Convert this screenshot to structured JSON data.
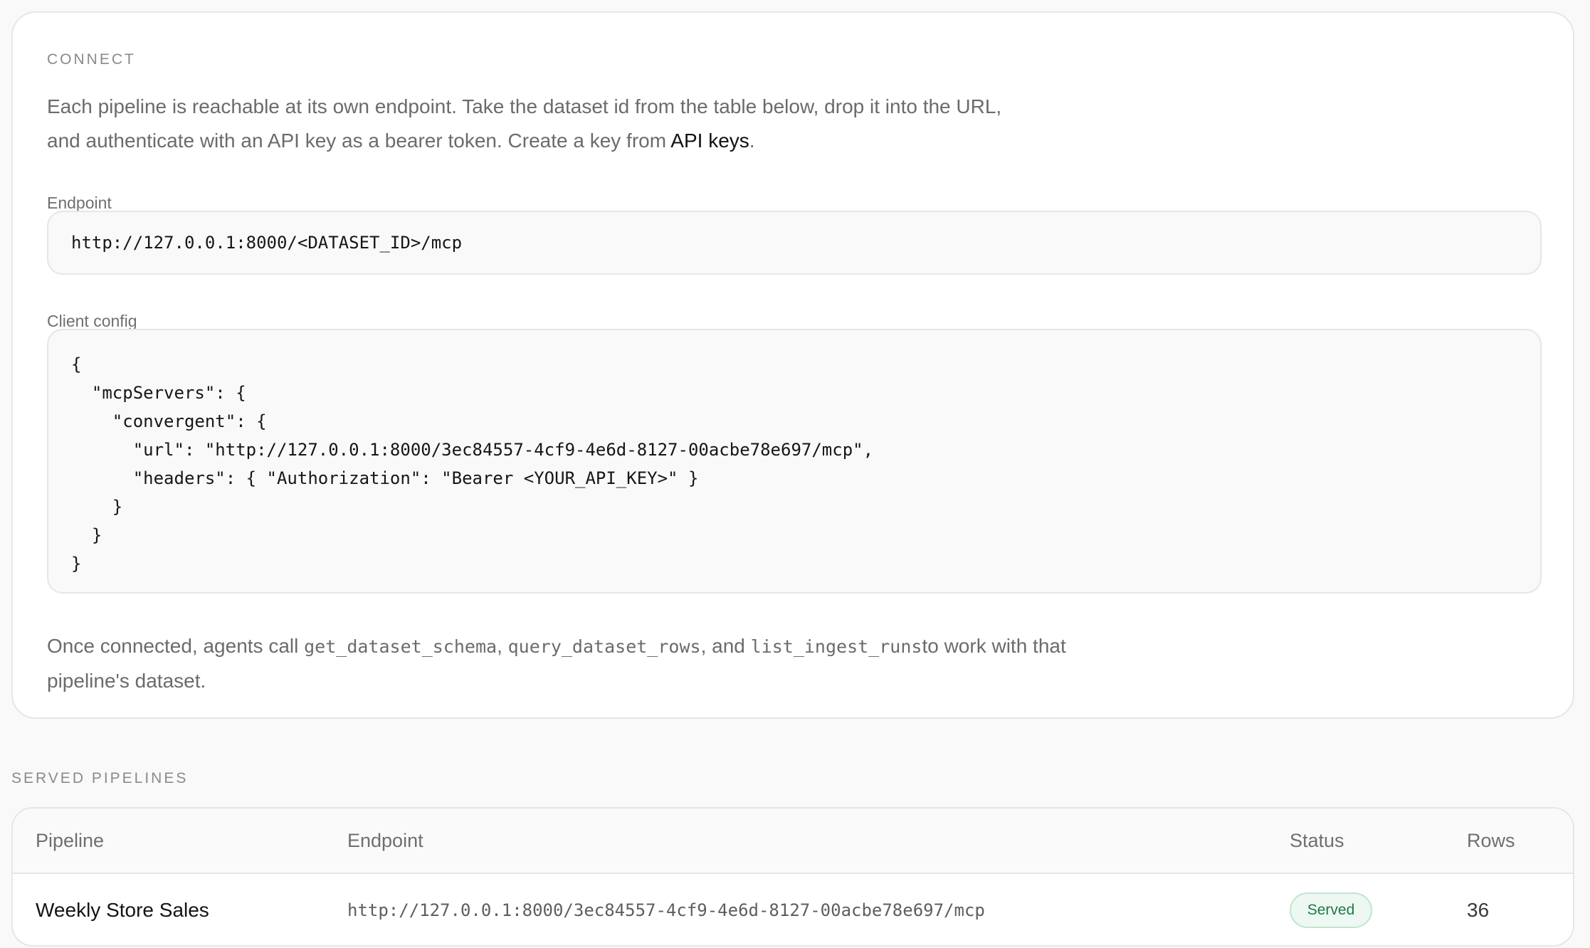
{
  "connect": {
    "section_label": "CONNECT",
    "intro_text": "Each pipeline is reachable at its own endpoint. Take the dataset id from the table below, drop it into the URL, and authenticate with an API key as a bearer token. Create a key from ",
    "api_keys_link": "API keys",
    "intro_suffix": ".",
    "endpoint_label": "Endpoint",
    "endpoint_value": "http://127.0.0.1:8000/<DATASET_ID>/mcp",
    "client_config_label": "Client config",
    "client_config_code": "{\n  \"mcpServers\": {\n    \"convergent\": {\n      \"url\": \"http://127.0.0.1:8000/3ec84557-4cf9-4e6d-8127-00acbe78e697/mcp\",\n      \"headers\": { \"Authorization\": \"Bearer <YOUR_API_KEY>\" }\n    }\n  }\n}",
    "outro_prefix": "Once connected, agents call ",
    "tool_1": "get_dataset_schema",
    "sep_1": ", ",
    "tool_2": "query_dataset_rows",
    "sep_2": ", and ",
    "tool_3": "list_ingest_runs",
    "outro_suffix": "to work with that pipeline's dataset."
  },
  "served": {
    "section_label": "SERVED PIPELINES",
    "columns": {
      "pipeline": "Pipeline",
      "endpoint": "Endpoint",
      "status": "Status",
      "rows": "Rows"
    },
    "rows": [
      {
        "pipeline": "Weekly Store Sales",
        "endpoint": "http://127.0.0.1:8000/3ec84557-4cf9-4e6d-8127-00acbe78e697/mcp",
        "status": "Served",
        "rows": "36"
      }
    ]
  },
  "colors": {
    "page_background": "#f9f9f9",
    "card_background": "#ffffff",
    "border": "#e6e6e6",
    "served_badge_text": "#1e7a48",
    "served_badge_background": "#ecf8f1"
  }
}
